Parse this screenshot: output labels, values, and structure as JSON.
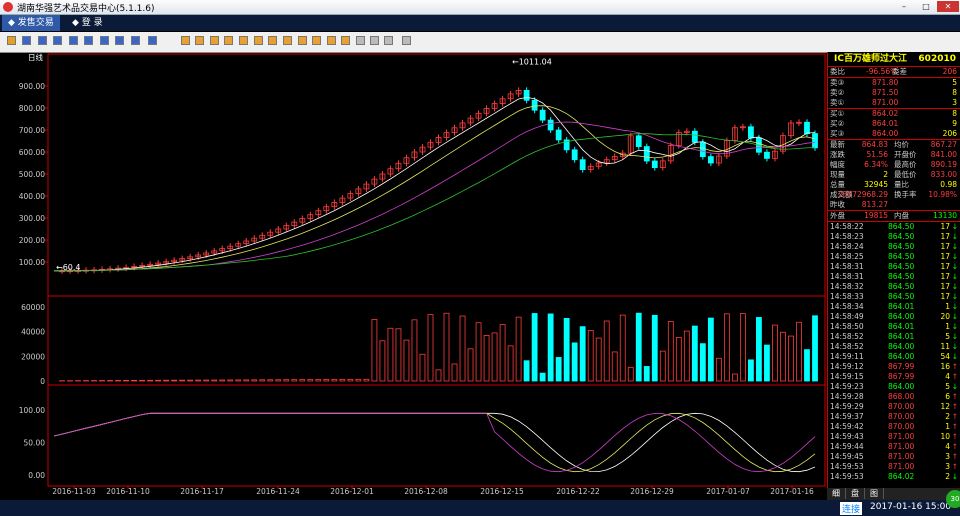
{
  "window": {
    "title": "湖南华强艺术品交易中心(5.1.1.6)",
    "min": "–",
    "max": "□",
    "close": "✕"
  },
  "menu": [
    {
      "label": "发售交易",
      "active": true
    },
    {
      "label": "登  录",
      "active": false
    }
  ],
  "chart": {
    "period_label": "日线",
    "y_ticks": [
      "900.00",
      "800.00",
      "700.00",
      "600.00",
      "500.00",
      "400.00",
      "300.00",
      "200.00",
      "100.00"
    ],
    "high_label": "1011.04",
    "low_label": "60.4",
    "vol_ticks": [
      "60000",
      "40000",
      "20000",
      "0"
    ],
    "ind_ticks": [
      "100.00",
      "50.00",
      "0.00"
    ],
    "x_ticks": [
      "2016-11-03",
      "2016-11-10",
      "2016-11-17",
      "2016-11-24",
      "2016-12-01",
      "2016-12-08",
      "2016-12-15",
      "2016-12-22",
      "2016-12-29",
      "2017-01-07",
      "2017-01-16"
    ]
  },
  "quote": {
    "name": "IC百万雄师过大江",
    "code": "602010",
    "weibi": {
      "label": "委比",
      "value": "-96.56%",
      "label2": "委差",
      "value2": "206"
    },
    "sells": [
      {
        "label": "卖③",
        "price": "871.80",
        "vol": "5"
      },
      {
        "label": "卖②",
        "price": "871.50",
        "vol": "8"
      },
      {
        "label": "卖①",
        "price": "871.00",
        "vol": "3"
      }
    ],
    "buys": [
      {
        "label": "买①",
        "price": "864.02",
        "vol": "8"
      },
      {
        "label": "买②",
        "price": "864.01",
        "vol": "9"
      },
      {
        "label": "买③",
        "price": "864.00",
        "vol": "206"
      }
    ],
    "stats": [
      {
        "l1": "最新",
        "v1": "864.83",
        "l2": "均价",
        "v2": "867.27"
      },
      {
        "l1": "涨跌",
        "v1": "51.56",
        "l2": "开盘价",
        "v2": "841.00"
      },
      {
        "l1": "幅度",
        "v1": "6.34%",
        "l2": "最高价",
        "v2": "890.19"
      },
      {
        "l1": "现量",
        "v1": "2",
        "l2": "最低价",
        "v2": "833.00"
      },
      {
        "l1": "总量",
        "v1": "32945",
        "l2": "量比",
        "v2": "0.98"
      },
      {
        "l1": "成交额",
        "v1": "28572968.29",
        "l2": "换手率",
        "v2": "10.98%"
      },
      {
        "l1": "昨收",
        "v1": "813.27",
        "l2": "",
        "v2": ""
      }
    ],
    "outer": {
      "l1": "外盘",
      "v1": "19815",
      "l2": "内盘",
      "v2": "13130"
    },
    "ticks": [
      [
        "14:58:22",
        "864.50",
        "17"
      ],
      [
        "14:58:23",
        "864.50",
        "17"
      ],
      [
        "14:58:24",
        "864.50",
        "17"
      ],
      [
        "14:58:25",
        "864.50",
        "17"
      ],
      [
        "14:58:31",
        "864.50",
        "17"
      ],
      [
        "14:58:31",
        "864.50",
        "17"
      ],
      [
        "14:58:32",
        "864.50",
        "17"
      ],
      [
        "14:58:33",
        "864.50",
        "17"
      ],
      [
        "14:58:34",
        "864.01",
        "1"
      ],
      [
        "14:58:49",
        "864.00",
        "20"
      ],
      [
        "14:58:50",
        "864.01",
        "1"
      ],
      [
        "14:58:52",
        "864.01",
        "5"
      ],
      [
        "14:58:52",
        "864.00",
        "11"
      ],
      [
        "14:59:11",
        "864.00",
        "54"
      ],
      [
        "14:59:12",
        "867.99",
        "16"
      ],
      [
        "14:59:15",
        "867.99",
        "4"
      ],
      [
        "14:59:23",
        "864.00",
        "5"
      ],
      [
        "14:59:28",
        "868.00",
        "6"
      ],
      [
        "14:59:29",
        "870.00",
        "12"
      ],
      [
        "14:59:37",
        "870.00",
        "2"
      ],
      [
        "14:59:42",
        "870.00",
        "1"
      ],
      [
        "14:59:43",
        "871.00",
        "10"
      ],
      [
        "14:59:44",
        "871.00",
        "4"
      ],
      [
        "14:59:45",
        "871.00",
        "3"
      ],
      [
        "14:59:53",
        "871.00",
        "3"
      ],
      [
        "14:59:53",
        "864.02",
        "2"
      ]
    ],
    "tabs": [
      "细",
      "盘",
      "图"
    ]
  },
  "status": {
    "connection": "连接",
    "datetime": "2017-01-16  15:00"
  },
  "badge": "30",
  "colors": {
    "up": "#ff3c3c",
    "down": "#00ffff",
    "ma1": "#ffffff",
    "ma2": "#e8e860",
    "ma3": "#d040d0",
    "ma4": "#30c030"
  }
}
